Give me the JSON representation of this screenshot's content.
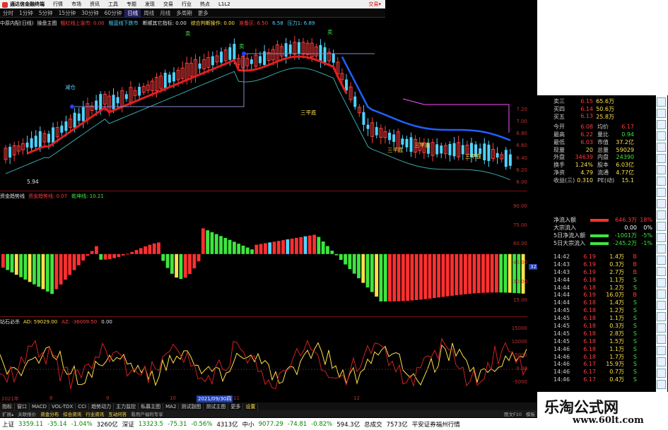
{
  "window": {
    "title": "通达信金融终端",
    "menu": [
      "行情",
      "市场",
      "资讯",
      "工具",
      "专题",
      "发现",
      "交易",
      "行业",
      "热点",
      "L1L2"
    ],
    "trade_link": "交易▾"
  },
  "periods": {
    "items": [
      "分时",
      "1分钟",
      "5分钟",
      "15分钟",
      "30分钟",
      "60分钟",
      "日线",
      "周线",
      "月线",
      "多周期",
      "更多"
    ],
    "active": "日线"
  },
  "main_panel": {
    "stock_name": "中原内配(日线)",
    "indicator_name": "操盘主图",
    "params": [
      {
        "text": "粗红线上涨市: 0.00",
        "color": "red"
      },
      {
        "text": "粗蓝线下跌市",
        "color": "cyan"
      },
      {
        "text": "断顺其它指标: 0.00",
        "color": "white"
      },
      {
        "text": "综合判断操作: 0.00",
        "color": "yellow"
      },
      {
        "text": "准备区: 6.50",
        "color": "red"
      },
      {
        "text": "6.58",
        "color": "cyan"
      },
      {
        "text": "压力1: 6.89",
        "color": "cyan"
      }
    ],
    "labels": {
      "sell": "卖",
      "reduce": "减仓",
      "buy_low": "三平底",
      "price_low": "5.94"
    },
    "price_axis": [
      "7.20",
      "7.00",
      "6.80",
      "6.60",
      "6.40",
      "6.20",
      "6.00"
    ]
  },
  "mid_panel": {
    "indicator_name": "资金趋势线",
    "params": [
      {
        "text": "资金趋势线: 0.07",
        "color": "red"
      },
      {
        "text": "乾坤线: 10.21",
        "color": "green"
      }
    ],
    "axis": [
      "90.00",
      "75.00",
      "60.00",
      "45.00",
      "30.00",
      "15.00"
    ],
    "cursor_value": "32.53"
  },
  "low_panel": {
    "indicator_name": "钻石必杀",
    "params": [
      {
        "text": "AD: 59029.00",
        "color": "yellow"
      },
      {
        "text": "AZ: -36009.50",
        "color": "red"
      },
      {
        "text": "0.00",
        "color": "white"
      }
    ],
    "axis": [
      "15000",
      "10000",
      "5000",
      "0.00",
      "-5000"
    ]
  },
  "date_axis": {
    "labels": [
      "2021年",
      "8",
      "9",
      "10",
      "11",
      "12"
    ],
    "cursor": "2021/09/30四"
  },
  "quote": {
    "asks": [
      {
        "label": "卖三",
        "price": "6.15",
        "vol": "65.6万"
      },
      {
        "label": "买四",
        "price": "6.14",
        "vol": "50.6万"
      },
      {
        "label": "买五",
        "price": "6.13",
        "vol": "25.8万"
      }
    ],
    "stats": [
      {
        "l1": "今开",
        "v1": "6.08",
        "l2": "均价",
        "v2": "6.17"
      },
      {
        "l1": "最高",
        "v1": "6.22",
        "l2": "量比",
        "v2": "0.94"
      },
      {
        "l1": "最低",
        "v1": "6.03",
        "l2": "市值",
        "v2": "37.2亿"
      },
      {
        "l1": "现量",
        "v1": "20",
        "l2": "总量",
        "v2": "59029"
      },
      {
        "l1": "外盘",
        "v1": "34639",
        "l2": "内盘",
        "v2": "24390"
      },
      {
        "l1": "换手",
        "v1": "1.24%",
        "l2": "股本",
        "v2": "6.03亿"
      },
      {
        "l1": "净资",
        "v1": "4.79",
        "l2": "流通",
        "v2": "4.77亿"
      },
      {
        "l1": "收益(三)",
        "v1": "0.310",
        "l2": "PE(动)",
        "v2": "15.1"
      }
    ],
    "flows": [
      {
        "label": "净流入额",
        "value": "646.3万",
        "pct": "18%",
        "bar": "red"
      },
      {
        "label": "大宗流入",
        "value": "0.00",
        "pct": "0%",
        "bar": "none"
      },
      {
        "label": "5日净流入额",
        "value": "-1001万",
        "pct": "-5%",
        "bar": "green"
      },
      {
        "label": "5日大宗流入",
        "value": "-245.2万",
        "pct": "-1%",
        "bar": "green"
      }
    ],
    "ticks": [
      {
        "t": "14:42",
        "p": "6.19",
        "v": "1.4万",
        "d": "B"
      },
      {
        "t": "14:43",
        "p": "6.19",
        "v": "0.3万",
        "d": "B"
      },
      {
        "t": "14:43",
        "p": "6.19",
        "v": "2.7万",
        "d": "B"
      },
      {
        "t": "14:44",
        "p": "6.18",
        "v": "1.1万",
        "d": "S"
      },
      {
        "t": "14:44",
        "p": "6.18",
        "v": "1.2万",
        "d": "S"
      },
      {
        "t": "14:44",
        "p": "6.19",
        "v": "16.0万",
        "d": "B"
      },
      {
        "t": "14:44",
        "p": "6.18",
        "v": "1.4万",
        "d": "S"
      },
      {
        "t": "14:45",
        "p": "6.18",
        "v": "1.2万",
        "d": "S"
      },
      {
        "t": "14:45",
        "p": "6.18",
        "v": "1.1万",
        "d": "S"
      },
      {
        "t": "14:45",
        "p": "6.18",
        "v": "0.3万",
        "d": "S"
      },
      {
        "t": "14:45",
        "p": "6.18",
        "v": "2.8万",
        "d": "S"
      },
      {
        "t": "14:45",
        "p": "6.18",
        "v": "1.5万",
        "d": "S"
      },
      {
        "t": "14:46",
        "p": "6.18",
        "v": "1.1万",
        "d": "S"
      },
      {
        "t": "14:46",
        "p": "6.18",
        "v": "1.7万",
        "d": "S"
      },
      {
        "t": "14:46",
        "p": "6.17",
        "v": "15.9万",
        "d": "S"
      },
      {
        "t": "14:46",
        "p": "6.17",
        "v": "0.7万",
        "d": "S"
      },
      {
        "t": "14:46",
        "p": "6.17",
        "v": "0.4万",
        "d": "S"
      }
    ]
  },
  "tabs_row1": [
    "指标",
    "窗口",
    "MACD",
    "VOL-TDX",
    "CCI",
    "趋势动力",
    "主力监控",
    "私募主图",
    "MA2",
    "测试副图",
    "测试主图",
    "更多",
    "设置"
  ],
  "tabs_row1_active": "设置",
  "tabs_row2": [
    "扩展▴",
    "关联报价",
    "资金分布",
    "综合资讯",
    "行业资讯",
    "互动问答",
    "看用户福利专享"
  ],
  "tabs_row2_right": [
    "图文F10",
    "模板"
  ],
  "status": [
    {
      "text": "上证",
      "cls": ""
    },
    {
      "text": "3359.11",
      "cls": "dn"
    },
    {
      "text": "-35.14",
      "cls": "dn"
    },
    {
      "text": "-1.04%",
      "cls": "dn"
    },
    {
      "text": "3260亿",
      "cls": ""
    },
    {
      "text": "深证",
      "cls": ""
    },
    {
      "text": "13323.5",
      "cls": "dn"
    },
    {
      "text": "-75.31",
      "cls": "dn"
    },
    {
      "text": "-0.56%",
      "cls": "dn"
    },
    {
      "text": "4313亿",
      "cls": ""
    },
    {
      "text": "中小",
      "cls": ""
    },
    {
      "text": "9077.29",
      "cls": "dn"
    },
    {
      "text": "-74.81",
      "cls": "dn"
    },
    {
      "text": "-0.82%",
      "cls": "dn"
    },
    {
      "text": "594.3亿",
      "cls": ""
    },
    {
      "text": "总成交",
      "cls": ""
    },
    {
      "text": "7573亿",
      "cls": ""
    },
    {
      "text": "平安证券福州行情",
      "cls": ""
    }
  ],
  "brand": {
    "title": "乐淘公式网",
    "url": "www.60lt.com"
  },
  "colors": {
    "up": "#ff3c3c",
    "down": "#3ee63e",
    "yellow": "#ffe14a",
    "cyan": "#4fd3ff",
    "blue": "#2060ff"
  }
}
